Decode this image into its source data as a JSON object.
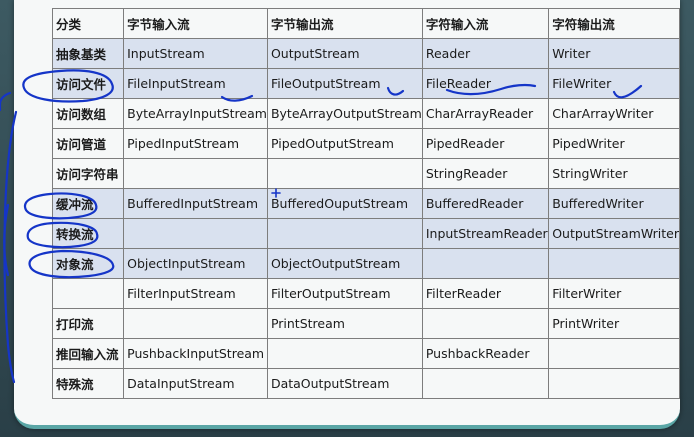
{
  "table": {
    "headers": [
      "分类",
      "字节输入流",
      "字节输出流",
      "字符输入流",
      "字符输出流"
    ],
    "rows": [
      {
        "cells": [
          "抽象基类",
          "InputStream",
          "OutputStream",
          "Reader",
          "Writer"
        ],
        "highlighted": true
      },
      {
        "cells": [
          "访问文件",
          "FileInputStream",
          "FileOutputStream",
          "FileReader",
          "FileWriter"
        ],
        "highlighted": true
      },
      {
        "cells": [
          "访问数组",
          "ByteArrayInputStream",
          "ByteArrayOutputStream",
          "CharArrayReader",
          "CharArrayWriter"
        ],
        "highlighted": false
      },
      {
        "cells": [
          "访问管道",
          "PipedInputStream",
          "PipedOutputStream",
          "PipedReader",
          "PipedWriter"
        ],
        "highlighted": false
      },
      {
        "cells": [
          "访问字符串",
          "",
          "",
          "StringReader",
          "StringWriter"
        ],
        "highlighted": false
      },
      {
        "cells": [
          "缓冲流",
          "BufferedInputStream",
          "BufferedOuputStream",
          "BufferedReader",
          "BufferedWriter"
        ],
        "highlighted": true
      },
      {
        "cells": [
          "转换流",
          "",
          "",
          "InputStreamReader",
          "OutputStreamWriter"
        ],
        "highlighted": true
      },
      {
        "cells": [
          "对象流",
          "ObjectInputStream",
          "ObjectOutputStream",
          "",
          ""
        ],
        "highlighted": true
      },
      {
        "cells": [
          "",
          "FilterInputStream",
          "FilterOutputStream",
          "FilterReader",
          "FilterWriter"
        ],
        "highlighted": false
      },
      {
        "cells": [
          "打印流",
          "",
          "PrintStream",
          "",
          "PrintWriter"
        ],
        "highlighted": false
      },
      {
        "cells": [
          "推回输入流",
          "PushbackInputStream",
          "",
          "PushbackReader",
          ""
        ],
        "highlighted": false
      },
      {
        "cells": [
          "特殊流",
          "DataInputStream",
          "DataOutputStream",
          "",
          ""
        ],
        "highlighted": false
      }
    ]
  },
  "colors": {
    "highlight_row": "#d9e1ef",
    "annotation_ink": "#1535c8",
    "slide_bg": "#f6f8f8",
    "frame_bg": "#2f4650"
  }
}
